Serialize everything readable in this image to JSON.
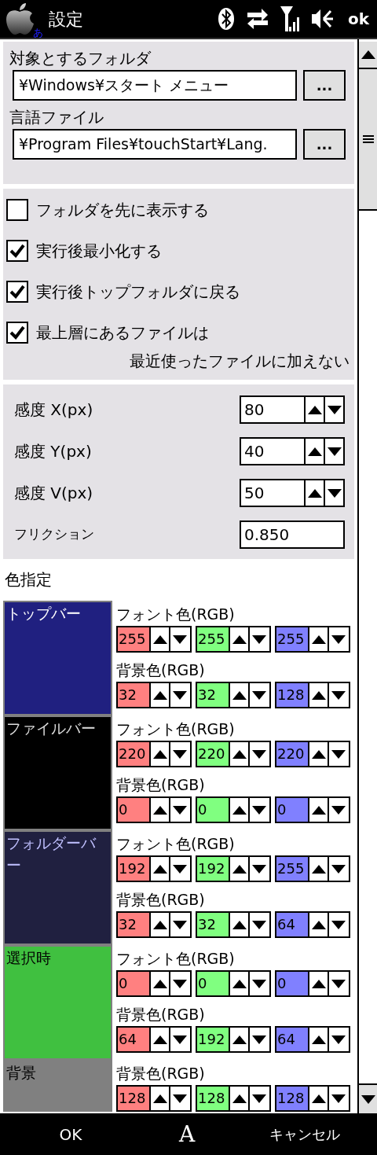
{
  "status_bar": {
    "title": "設定",
    "input_mode": "あ",
    "ok": "ok"
  },
  "paths": [
    {
      "label": "対象とするフォルダ",
      "value": "¥Windows¥スタート メニュー",
      "browse": "..."
    },
    {
      "label": "言語ファイル",
      "value": "¥Program Files¥touchStart¥Lang.",
      "browse": "..."
    }
  ],
  "options": [
    {
      "label": "フォルダを先に表示する",
      "checked": false
    },
    {
      "label": "実行後最小化する",
      "checked": true
    },
    {
      "label": "実行後トップフォルダに戻る",
      "checked": true
    },
    {
      "label": "最上層にあるファイルは",
      "label_continued": "最近使ったファイルに加えない",
      "checked": true
    }
  ],
  "sensitivity": [
    {
      "kind": "spin",
      "label": "感度 X(px)",
      "value": "80"
    },
    {
      "kind": "spin",
      "label": "感度 Y(px)",
      "value": "40"
    },
    {
      "kind": "spin",
      "label": "感度 V(px)",
      "value": "50"
    },
    {
      "kind": "field",
      "label": "フリクション",
      "value": "0.850"
    }
  ],
  "colors": {
    "title": "色指定",
    "items": [
      {
        "name": "トップバー",
        "rows": [
          {
            "kind": "font",
            "label": "フォント色(RGB)",
            "r": "255",
            "g": "255",
            "b": "255"
          },
          {
            "kind": "background",
            "label": "背景色(RGB)",
            "r": "32",
            "g": "32",
            "b": "128"
          }
        ]
      },
      {
        "name": "ファイルバー",
        "rows": [
          {
            "kind": "font",
            "label": "フォント色(RGB)",
            "r": "220",
            "g": "220",
            "b": "220"
          },
          {
            "kind": "background",
            "label": "背景色(RGB)",
            "r": "0",
            "g": "0",
            "b": "0"
          }
        ]
      },
      {
        "name": "フォルダーバー",
        "rows": [
          {
            "kind": "font",
            "label": "フォント色(RGB)",
            "r": "192",
            "g": "192",
            "b": "255"
          },
          {
            "kind": "background",
            "label": "背景色(RGB)",
            "r": "32",
            "g": "32",
            "b": "64"
          }
        ]
      },
      {
        "name": "選択時",
        "rows": [
          {
            "kind": "font",
            "label": "フォント色(RGB)",
            "r": "0",
            "g": "0",
            "b": "0"
          },
          {
            "kind": "background",
            "label": "背景色(RGB)",
            "r": "64",
            "g": "192",
            "b": "64"
          }
        ]
      },
      {
        "name": "背景",
        "rows": [
          {
            "kind": "background",
            "label": "背景色(RGB)",
            "r": "128",
            "g": "128",
            "b": "128"
          }
        ]
      }
    ]
  },
  "softkeys": {
    "left": "OK",
    "center": "A",
    "right": "キャンセル"
  }
}
